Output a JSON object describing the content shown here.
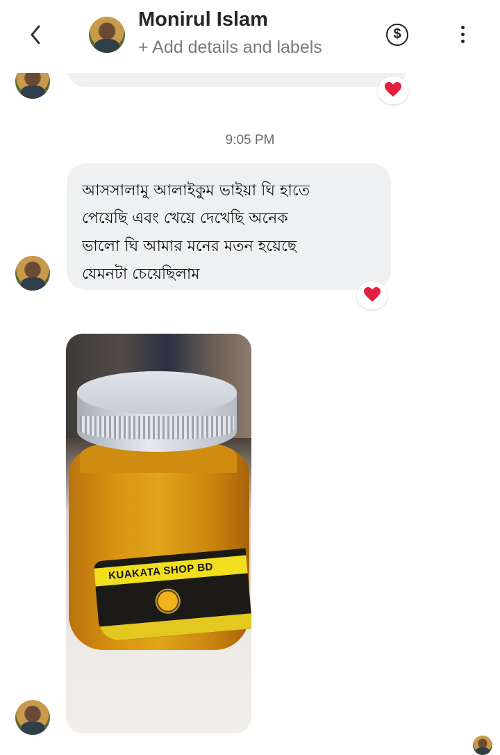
{
  "header": {
    "back_icon": "chevron-left-icon",
    "contact_name": "Monirul Islam",
    "subtitle": "+ Add details and labels",
    "payment_icon": "dollar-circle-icon",
    "payment_symbol": "$",
    "more_icon": "more-vertical-icon"
  },
  "messages": {
    "timestamp": "9:05 PM",
    "text_lines": [
      "আসসালামু আলাইকুম ভাইয়া ঘি হাতে",
      "পেয়েছি এবং খেয়ে দেখেছি অনেক",
      "ভালো ঘি আমার মনের মতন হয়েছে",
      "যেমনটা চেয়েছিলাম"
    ],
    "reaction_icon": "heart-icon",
    "reaction_color": "#e41e3f",
    "photo_label_text": "KUAKATA SHOP BD"
  },
  "colors": {
    "bubble": "#eef0f2",
    "text": "#050505",
    "muted": "#7a7a7a"
  }
}
